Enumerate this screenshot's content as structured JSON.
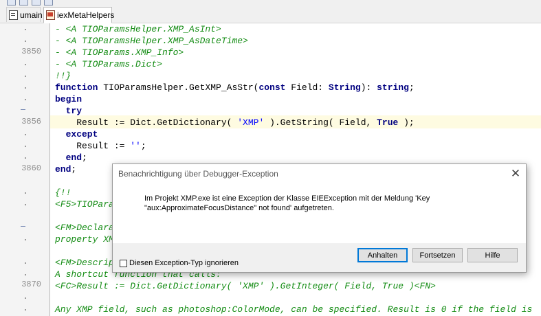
{
  "tabs": [
    {
      "label": "umain",
      "icon": "unit-file-icon",
      "active": false
    },
    {
      "label": "iexMetaHelpers",
      "icon": "meta-unit-icon",
      "active": true
    }
  ],
  "gutter": {
    "line_numbers": [
      "3850",
      "3856",
      "3860",
      "3870"
    ]
  },
  "code": {
    "l1": "- <A TIOParamsHelper.XMP_AsInt>",
    "l2": "- <A TIOParamsHelper.XMP_AsDateTime>",
    "l3": "- <A TIOParams.XMP_Info>",
    "l4": "- <A TIOParams.Dict>",
    "l5": "!!}",
    "l6_kw": "function",
    "l6_txt": " TIOParamsHelper.GetXMP_AsStr(",
    "l6_kw2": "const",
    "l6_txt2": " Field: ",
    "l6_kw3": "String",
    "l6_txt3": "): ",
    "l6_kw4": "string",
    "l6_txt4": ";",
    "l7": "begin",
    "l8": "  try",
    "l9_a": "    Result := Dict.GetDictionary( ",
    "l9_str": "'XMP'",
    "l9_b": " ).GetString( Field, ",
    "l9_kw": "True",
    "l9_c": " );",
    "l10": "  except",
    "l11_a": "    Result := ",
    "l11_str": "''",
    "l11_b": ";",
    "l12_kw": "  end",
    "l12_txt": ";",
    "l13_kw": "end",
    "l13_txt": ";",
    "l15": "{!!",
    "l16": "<F5>TIOParar",
    "l18": "<FM>Declara",
    "l19": "property XM",
    "l21": "<FM>Descrip",
    "l22": "A shortcut function that calls:",
    "l23": "<FC>Result := Dict.GetDictionary( 'XMP' ).GetInteger( Field, True )<FN>",
    "l25": "Any XMP field, such as photoshop:ColorMode, can be specified. Result is 0 if the field is"
  },
  "dialog": {
    "title": "Benachrichtigung über Debugger-Exception",
    "close_glyph": "✕",
    "message": "Im Projekt XMP.exe ist eine Exception der Klasse EIEException mit der Meldung 'Key\n\"aux:ApproximateFocusDistance\" not found' aufgetreten.",
    "checkbox_label": "Diesen Exception-Typ ignorieren",
    "checkbox_checked": false,
    "buttons": {
      "anhalten": "Anhalten",
      "fortsetzen": "Fortsetzen",
      "hilfe": "Hilfe"
    }
  },
  "colors": {
    "comment": "#148c14",
    "keyword": "#000080",
    "string": "#0000ff",
    "current_line": "#fefbe1",
    "default_button_border": "#0078d7"
  }
}
